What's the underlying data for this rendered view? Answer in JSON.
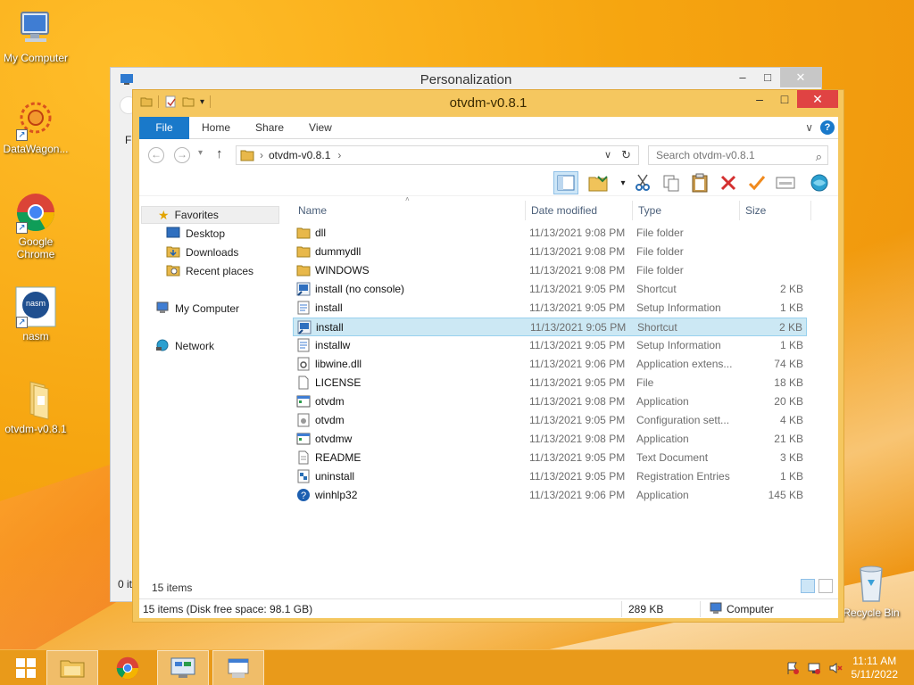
{
  "desktop": {
    "icons": [
      {
        "label": "My Computer",
        "icon": "computer-icon"
      },
      {
        "label": "DataWagon...",
        "icon": "datawagon-icon"
      },
      {
        "label": "Google Chrome",
        "icon": "chrome-icon"
      },
      {
        "label": "nasm",
        "icon": "nasm-icon",
        "glyph_text": "nasm"
      },
      {
        "label": "otvdm-v0.8.1",
        "icon": "folder-icon"
      },
      {
        "label": "Recycle Bin",
        "icon": "recycle-bin-icon"
      }
    ]
  },
  "bg_window": {
    "title": "Personalization",
    "partial_label_fi": "Fi",
    "partial_label_0": "0 it",
    "minimize": "–",
    "maximize": "□",
    "close": "✕"
  },
  "explorer": {
    "title": "otvdm-v0.8.1",
    "controls": {
      "minimize": "–",
      "maximize": "□",
      "close": "✕"
    },
    "ribbon_tabs": [
      "File",
      "Home",
      "Share",
      "View"
    ],
    "ribbon_expand": "∨",
    "help": "?",
    "nav": {
      "back": "←",
      "forward": "→",
      "recent": "▾",
      "up": "↑"
    },
    "address": {
      "path": "otvdm-v0.8.1",
      "sep1": "›",
      "sep2": "›",
      "dropdown": "∨",
      "refresh": "↻"
    },
    "search": {
      "placeholder": "Search otvdm-v0.8.1",
      "icon": "⌕"
    },
    "columns": {
      "name": "Name",
      "date": "Date modified",
      "type": "Type",
      "size": "Size"
    },
    "nav_pane": {
      "favorites": "Favorites",
      "desktop": "Desktop",
      "downloads": "Downloads",
      "recent": "Recent places",
      "computer": "My Computer",
      "network": "Network"
    },
    "files": [
      {
        "name": "dll",
        "date": "11/13/2021 9:08 PM",
        "type": "File folder",
        "size": "",
        "icon": "folder-icon"
      },
      {
        "name": "dummydll",
        "date": "11/13/2021 9:08 PM",
        "type": "File folder",
        "size": "",
        "icon": "folder-icon"
      },
      {
        "name": "WINDOWS",
        "date": "11/13/2021 9:08 PM",
        "type": "File folder",
        "size": "",
        "icon": "folder-icon"
      },
      {
        "name": "install (no console)",
        "date": "11/13/2021 9:05 PM",
        "type": "Shortcut",
        "size": "2 KB",
        "icon": "shortcut-icon"
      },
      {
        "name": "install",
        "date": "11/13/2021 9:05 PM",
        "type": "Setup Information",
        "size": "1 KB",
        "icon": "setup-info-icon"
      },
      {
        "name": "install",
        "date": "11/13/2021 9:05 PM",
        "type": "Shortcut",
        "size": "2 KB",
        "icon": "shortcut-icon",
        "selected": true
      },
      {
        "name": "installw",
        "date": "11/13/2021 9:05 PM",
        "type": "Setup Information",
        "size": "1 KB",
        "icon": "setup-info-icon"
      },
      {
        "name": "libwine.dll",
        "date": "11/13/2021 9:06 PM",
        "type": "Application extens...",
        "size": "74 KB",
        "icon": "dll-icon"
      },
      {
        "name": "LICENSE",
        "date": "11/13/2021 9:05 PM",
        "type": "File",
        "size": "18 KB",
        "icon": "file-icon"
      },
      {
        "name": "otvdm",
        "date": "11/13/2021 9:08 PM",
        "type": "Application",
        "size": "20 KB",
        "icon": "application-icon"
      },
      {
        "name": "otvdm",
        "date": "11/13/2021 9:05 PM",
        "type": "Configuration sett...",
        "size": "4 KB",
        "icon": "config-icon"
      },
      {
        "name": "otvdmw",
        "date": "11/13/2021 9:08 PM",
        "type": "Application",
        "size": "21 KB",
        "icon": "application-icon"
      },
      {
        "name": "README",
        "date": "11/13/2021 9:05 PM",
        "type": "Text Document",
        "size": "3 KB",
        "icon": "text-doc-icon"
      },
      {
        "name": "uninstall",
        "date": "11/13/2021 9:05 PM",
        "type": "Registration Entries",
        "size": "1 KB",
        "icon": "registry-icon"
      },
      {
        "name": "winhlp32",
        "date": "11/13/2021 9:06 PM",
        "type": "Application",
        "size": "145 KB",
        "icon": "help-app-icon"
      }
    ],
    "count_label": "15 items",
    "status": {
      "left": "15 items (Disk free space: 98.1 GB)",
      "size": "289 KB",
      "location": "Computer"
    }
  },
  "taskbar": {
    "clock_time": "11:11 AM",
    "clock_date": "5/11/2022"
  }
}
